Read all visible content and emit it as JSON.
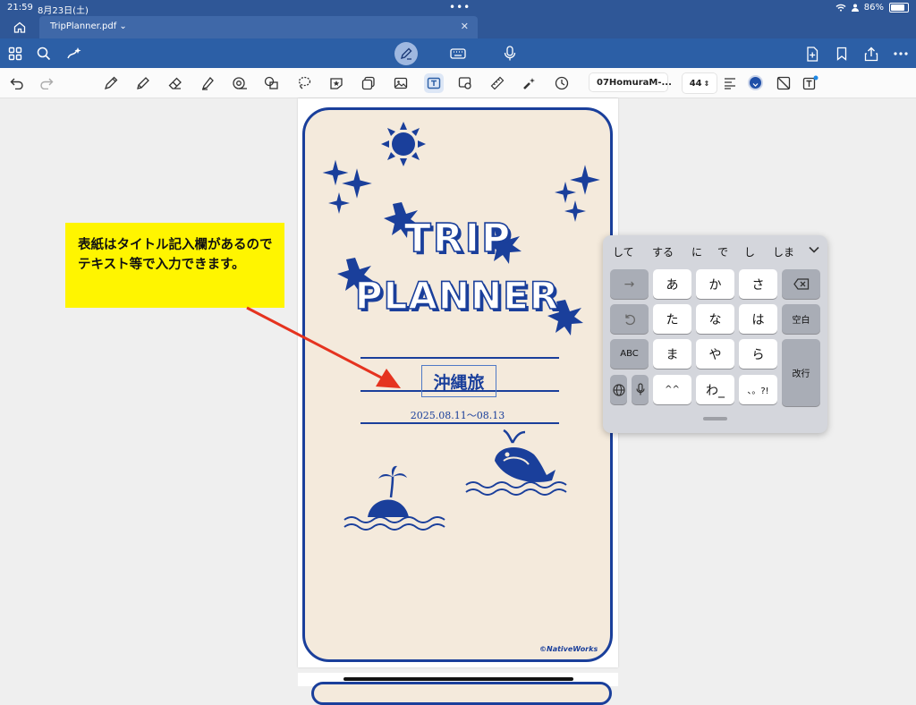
{
  "status": {
    "time": "21:59",
    "date": "8月23日(土)",
    "battery": "86%"
  },
  "tab": {
    "title": "TripPlanner.pdf"
  },
  "toolbar": {
    "font_name": "07HomuraM-...",
    "font_size": "44"
  },
  "page": {
    "title_field": "沖縄旅",
    "date_range": "2025.08.11〜08.13",
    "credit": "©NativeWorks"
  },
  "callout": {
    "text": "表紙はタイトル記入欄があるのでテキスト等で入力できます。"
  },
  "keyboard": {
    "candidates": [
      "して",
      "する",
      "に",
      "で",
      "し",
      "しま"
    ],
    "keys": {
      "a": "あ",
      "ka": "か",
      "sa": "さ",
      "ta": "た",
      "na": "な",
      "ha": "は",
      "ma": "ま",
      "ya": "や",
      "ra": "ら",
      "caret": "^^",
      "wa": "わ_",
      "punct": "、。?!",
      "abc": "ABC",
      "space": "空白",
      "enter": "改行",
      "arrow": "→"
    }
  },
  "colors": {
    "accent_blue": "#2c5fa6",
    "ink_navy": "#1a3f9b",
    "card_beige": "#f4eadc",
    "callout_yellow": "#fff500",
    "arrow_red": "#e5331f"
  }
}
